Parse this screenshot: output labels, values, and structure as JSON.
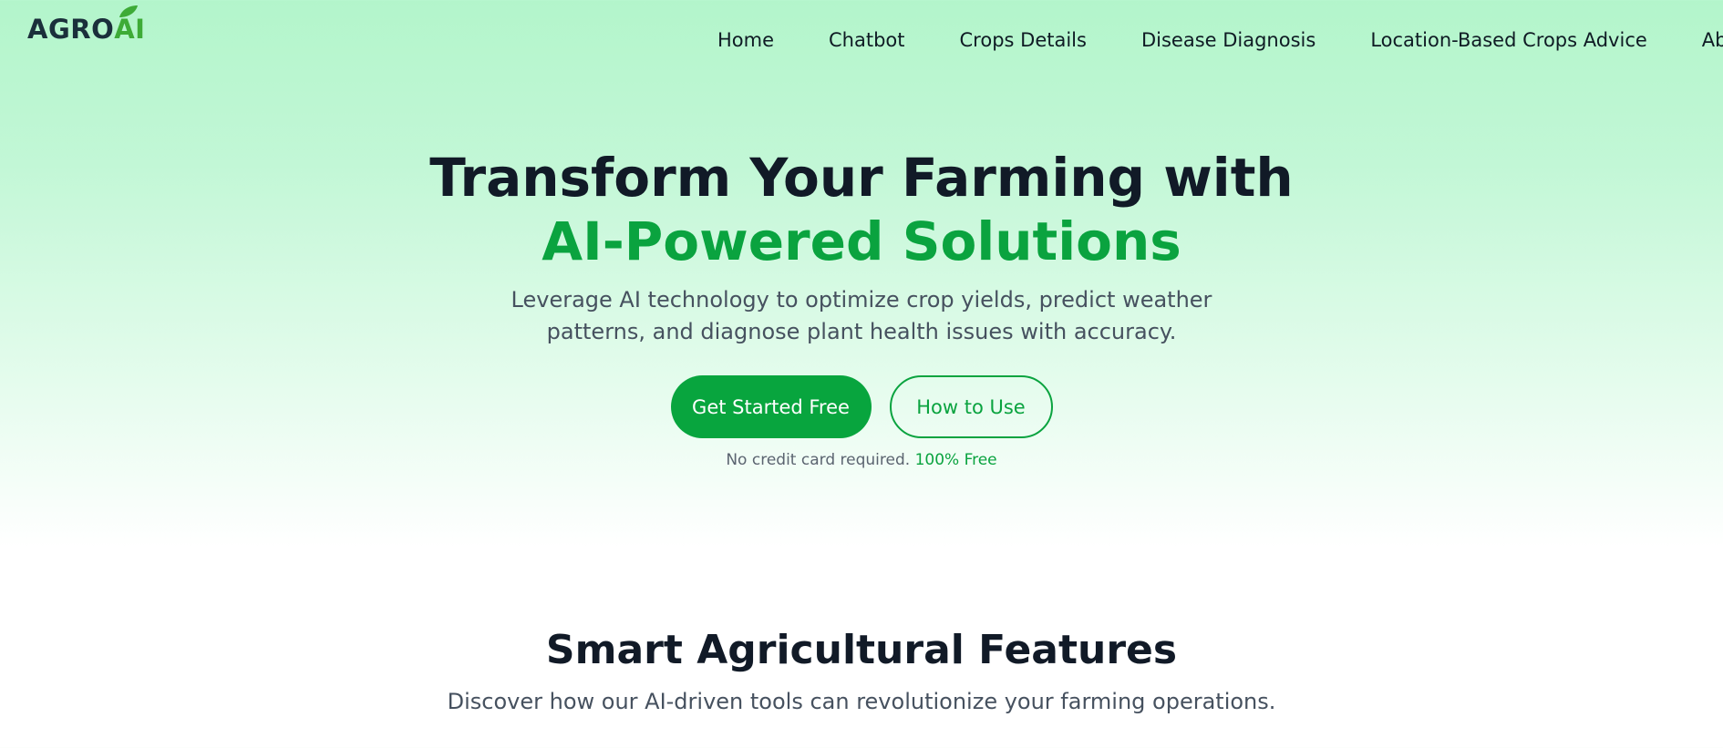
{
  "header": {
    "logo": {
      "part1": "AGRO",
      "part2": "AI"
    },
    "nav": [
      {
        "label": "Home"
      },
      {
        "label": "Chatbot"
      },
      {
        "label": "Crops Details"
      },
      {
        "label": "Disease Diagnosis"
      },
      {
        "label": "Location-Based Crops Advice"
      },
      {
        "label": "About"
      }
    ]
  },
  "hero": {
    "title_line1": "Transform Your Farming with",
    "title_line2": "AI-Powered Solutions",
    "subtitle": "Leverage AI technology to optimize crop yields, predict weather patterns, and diagnose plant health issues with accuracy.",
    "primary_button": "Get Started Free",
    "secondary_button": "How to Use",
    "note": "No credit card required.",
    "note_highlight": "100% Free"
  },
  "features": {
    "title": "Smart Agricultural Features",
    "subtitle": "Discover how our AI-driven tools can revolutionize your farming operations."
  },
  "colors": {
    "brand_green": "#0aa33f",
    "logo_dark": "#1b2f3b",
    "logo_leaf": "#3eab37",
    "heading": "#111a27"
  }
}
